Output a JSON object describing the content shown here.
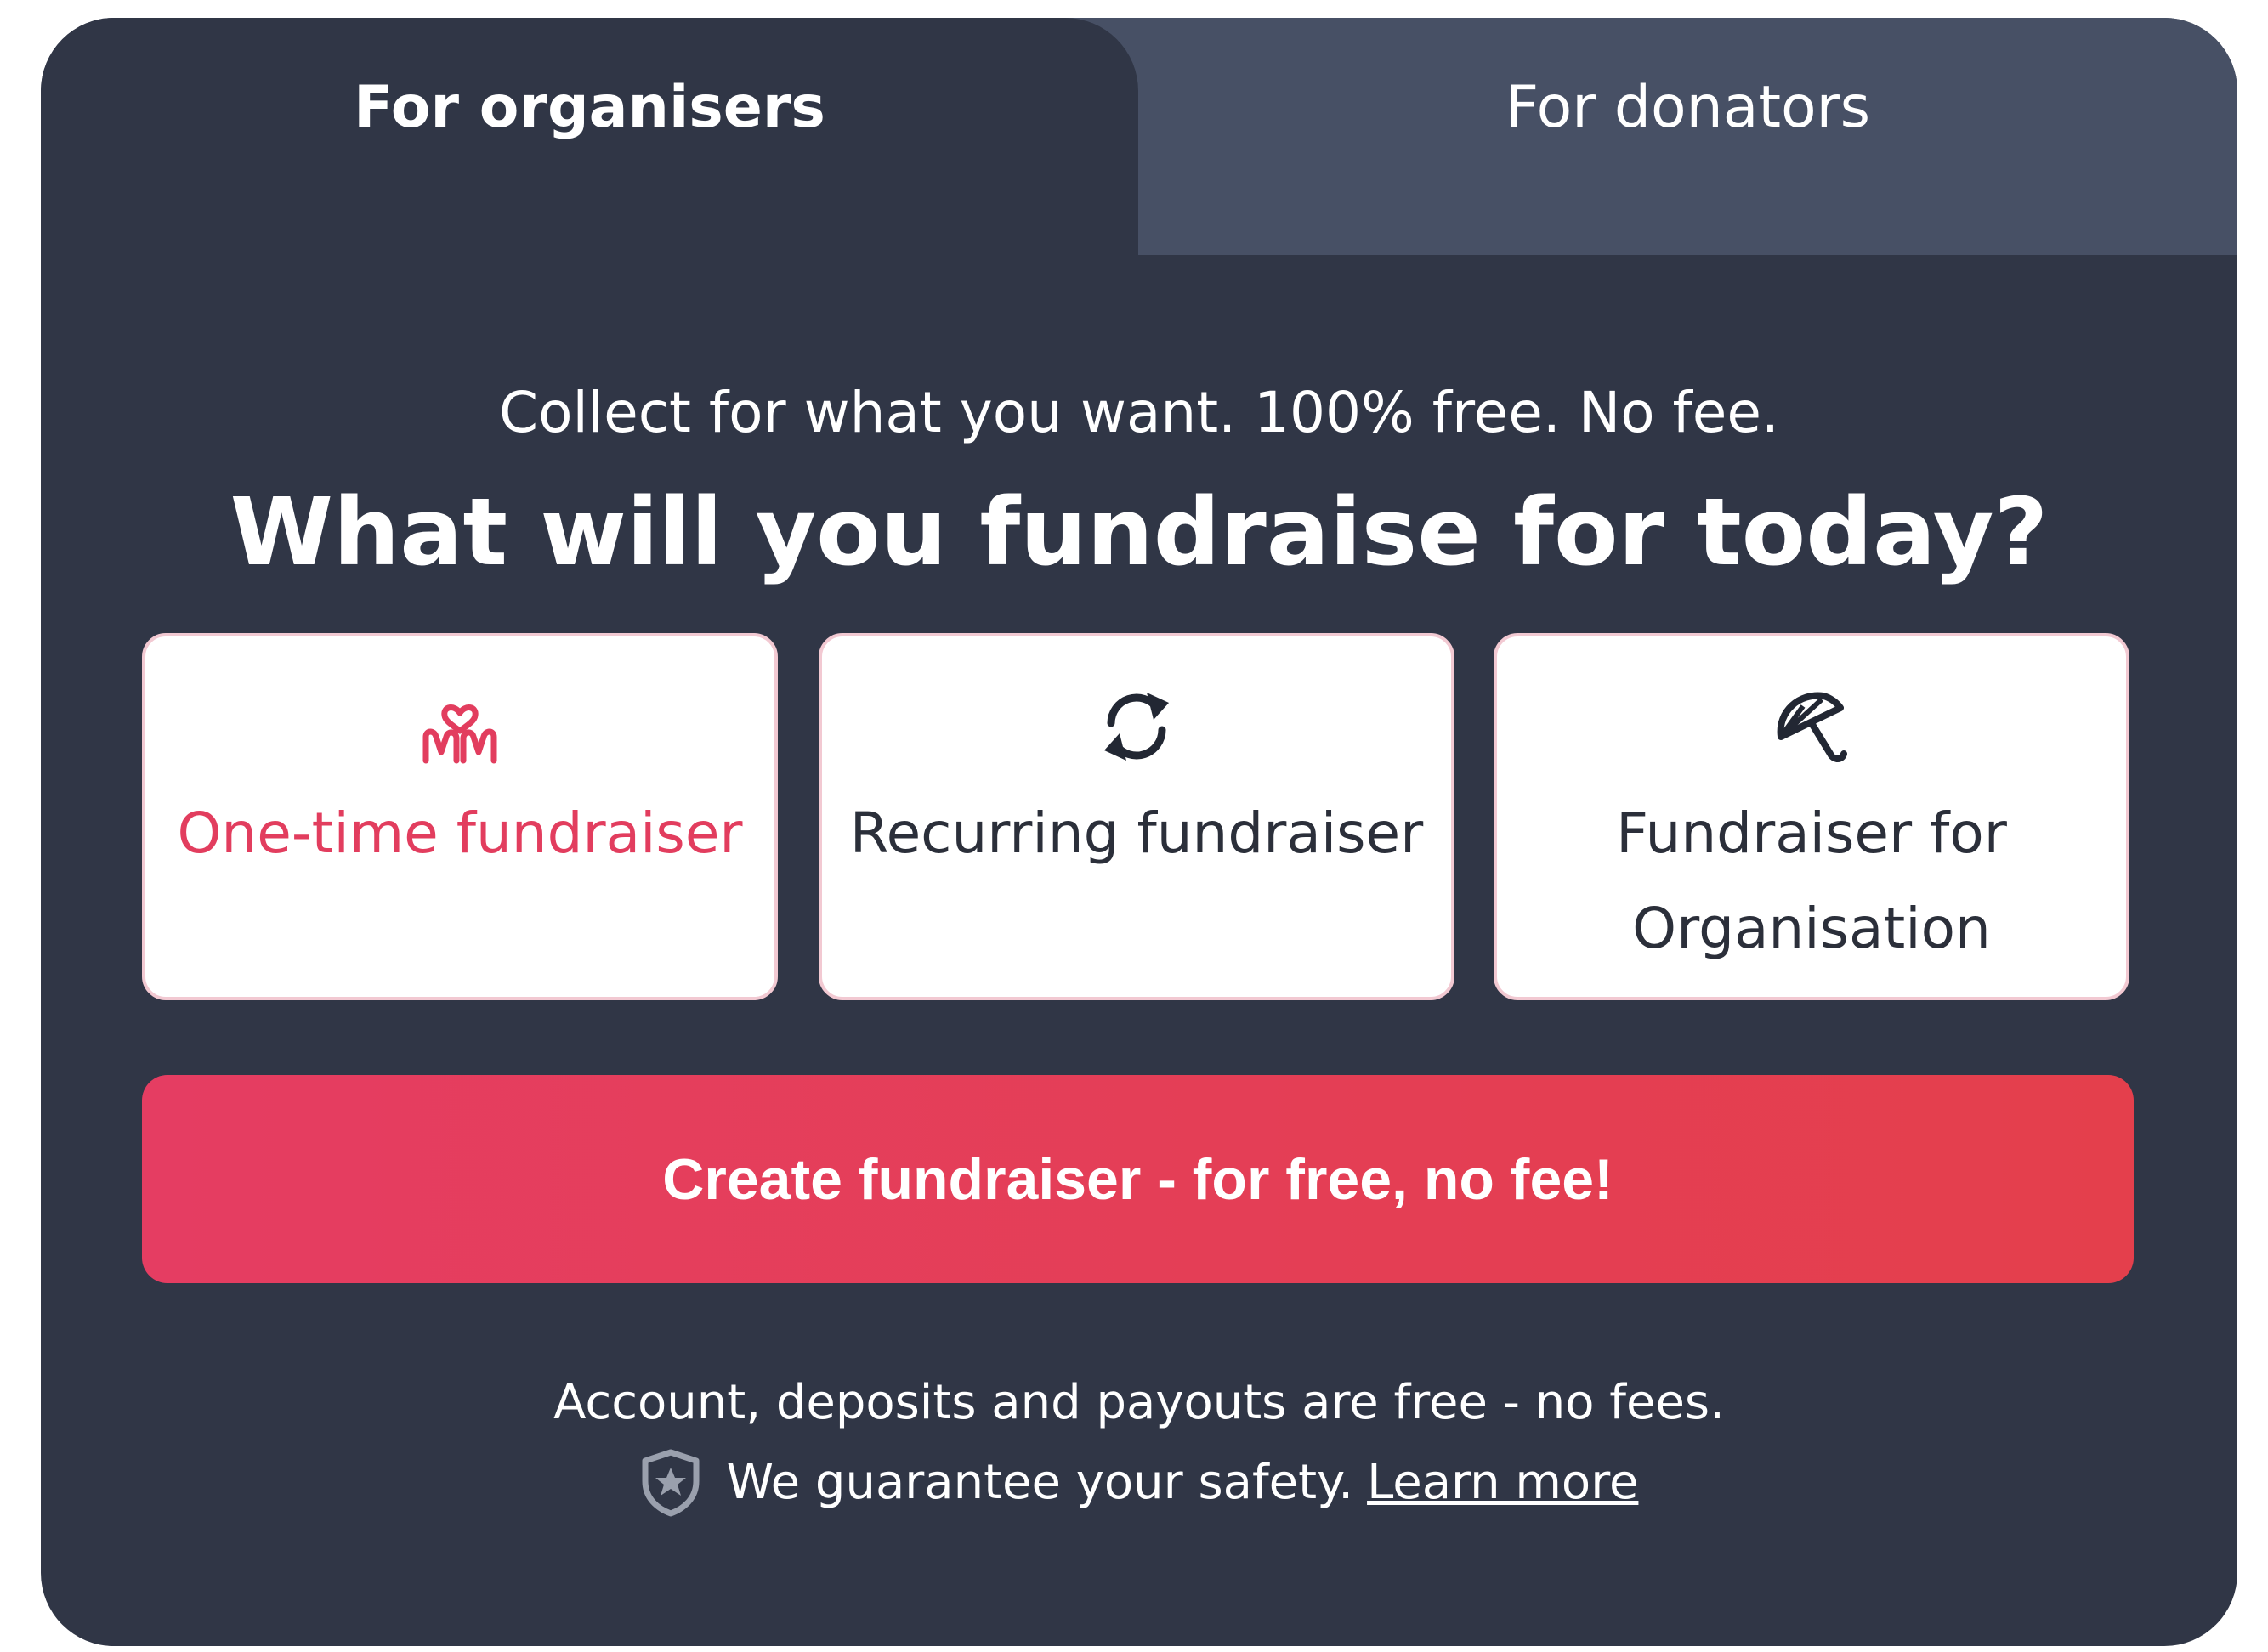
{
  "tabs": {
    "organisers": "For organisers",
    "donators": "For donators"
  },
  "header": {
    "subtitle": "Collect for what you want. 100% free. No fee.",
    "title": "What will you fundraise for today?"
  },
  "options": [
    {
      "label": "One-time fundraiser",
      "icon": "hands-heart-icon",
      "selected": true
    },
    {
      "label": "Recurring fundraiser",
      "icon": "refresh-icon",
      "selected": false
    },
    {
      "label": "Fundraiser for Organisation",
      "icon": "umbrella-icon",
      "selected": false
    }
  ],
  "cta": {
    "label": "Create fundraiser - for free, no fee!"
  },
  "footer": {
    "line1": "Account, deposits and payouts are free - no fees.",
    "safety_text": "We guarantee your safety.",
    "learn_more": "Learn more"
  },
  "colors": {
    "background": "#303646",
    "inactive_tab": "#475065",
    "accent": "#e23d5e",
    "cta_start": "#e53d62",
    "cta_end": "#e43f4c"
  }
}
